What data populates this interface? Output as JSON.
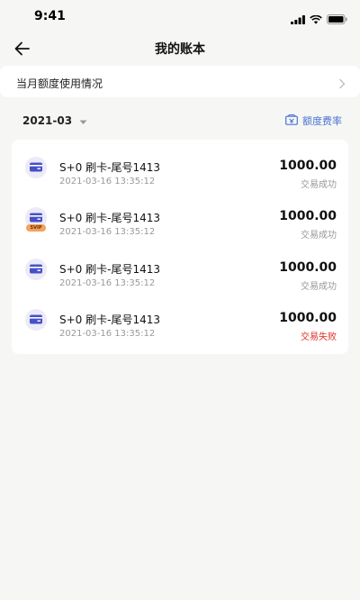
{
  "status_bar": {
    "time": "9:41"
  },
  "nav": {
    "title": "我的账本"
  },
  "usage": {
    "label": "当月额度使用情况"
  },
  "filter": {
    "month": "2021-03",
    "rate_label": "额度费率"
  },
  "colors": {
    "accent": "#4a73d4",
    "fail": "#e0302b",
    "icon_bg": "#eceaf7",
    "icon_fg": "#4650c8",
    "svip": "#f2a25a"
  },
  "transactions": [
    {
      "title": "S+0 刷卡-尾号1413",
      "time": "2021-03-16 13:35:12",
      "amount": "1000.00",
      "status": "交易成功",
      "icon": "card-icon",
      "badge": ""
    },
    {
      "title": "S+0 刷卡-尾号1413",
      "time": "2021-03-16 13:35:12",
      "amount": "1000.00",
      "status": "交易成功",
      "icon": "card-icon",
      "badge": "SVIP"
    },
    {
      "title": "S+0 刷卡-尾号1413",
      "time": "2021-03-16 13:35:12",
      "amount": "1000.00",
      "status": "交易成功",
      "icon": "card-icon",
      "badge": ""
    },
    {
      "title": "S+0 刷卡-尾号1413",
      "time": "2021-03-16 13:35:12",
      "amount": "1000.00",
      "status": "交易失败",
      "icon": "card-icon",
      "badge": ""
    }
  ]
}
